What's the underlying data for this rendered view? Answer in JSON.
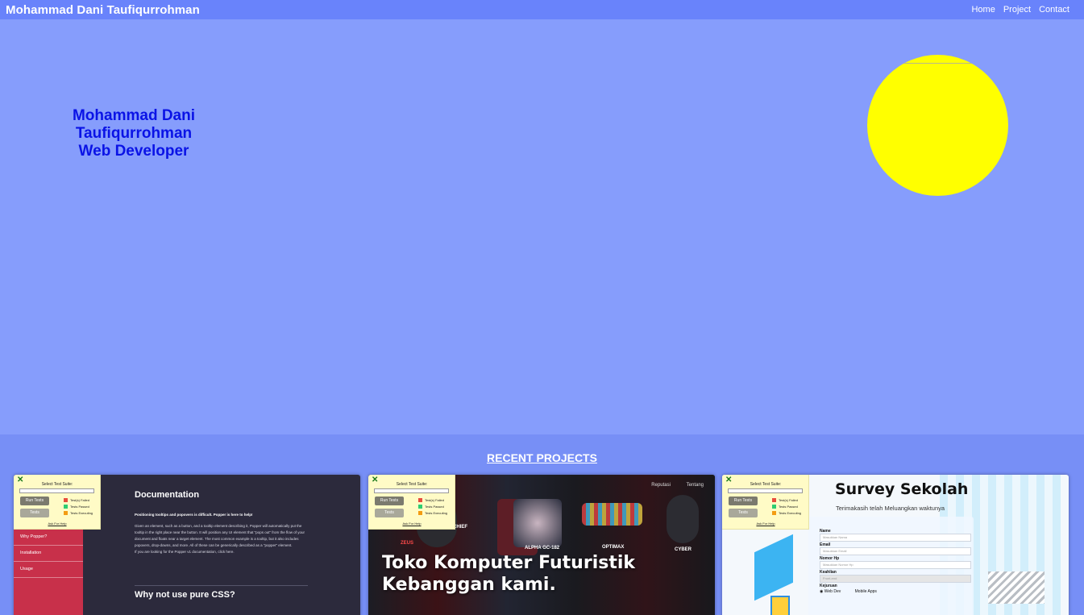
{
  "nav": {
    "brand": "Mohammad Dani Taufiqurrohman",
    "links": [
      "Home",
      "Project",
      "Contact"
    ]
  },
  "hero": {
    "name": "Mohammad Dani Taufiqurrohman",
    "role": "Web Developer"
  },
  "projects": {
    "title": "RECENT PROJECTS",
    "test_suite": {
      "title": "Select Test Suite:",
      "run_label": "Run Tests",
      "tests_label": "Tests",
      "legend": [
        "Test(s) Failed",
        "Tests Passed",
        "Tests Executing"
      ],
      "help": "Ask For Help"
    },
    "card1": {
      "sidebar": [
        "Why Popper?",
        "Installation",
        "Usage"
      ],
      "heading": "Documentation",
      "lead": "Positioning tooltips and popovers is difficult. Popper is here to help!",
      "body": "Given an element, such as a button, and a tooltip element describing it, Popper will automatically put the tooltip in the right place near the button. It will position any UI element that \"pops out\" from the flow of your document and floats near a target element. The most common example is a tooltip, but it also includes popovers, drop-downs, and more. All of these can be generically described as a \"popper\" element.",
      "footnote": "If you are looking for the Popper v1 documentation, click here.",
      "heading2": "Why not use pure CSS?"
    },
    "card2": {
      "nav": [
        "Reputasi",
        "Tentang"
      ],
      "labels": [
        "ZEUS",
        "CHIEF",
        "ALPHA GC-182",
        "OPTIMAX",
        "CYBER"
      ],
      "title_line1": "Toko Komputer Futuristik",
      "title_line2": "Kebanggan kami."
    },
    "card3": {
      "title": "Survey Sekolah",
      "subtitle": "Terimakasih telah Meluangkan waktunya",
      "fields": [
        {
          "label": "Name",
          "placeholder": "Masukkan Nama"
        },
        {
          "label": "Email",
          "placeholder": "Masukkan Email"
        },
        {
          "label": "Nomor Hp",
          "placeholder": "Masukkan Nomor Hp"
        }
      ],
      "skill_label": "Keahlian",
      "skill_value": "Front-end",
      "major_label": "Kejuruan",
      "major_options": [
        "Web Dev",
        "Mobile Apps"
      ]
    }
  },
  "colors": {
    "nav_bg": "#6983fb",
    "hero_bg": "#869dfc",
    "projects_bg": "#778ff6",
    "hero_text": "#0a13e6",
    "sun": "#ffff00"
  }
}
